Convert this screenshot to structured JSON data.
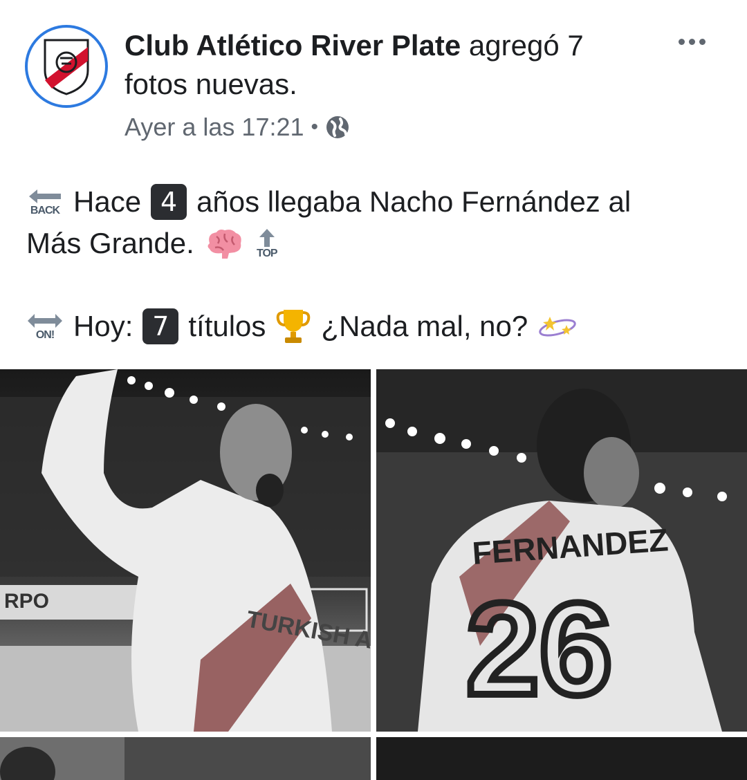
{
  "post": {
    "page_name": "Club Atlético River Plate",
    "action_text": " agregó 7 fotos nuevas.",
    "timestamp": "Ayer a las 17:21",
    "privacy_icon": "globe-icon",
    "more_icon": "more-icon"
  },
  "text": {
    "line1_prefix": "Hace",
    "line1_key": "4",
    "line1_rest": "años llegaba Nacho Fernández al",
    "line2": "Más Grande.",
    "line3_prefix": "Hoy:",
    "line3_key": "7",
    "line3_rest1": "títulos",
    "line3_rest2": "¿Nada mal, no?",
    "back_label": "BACK",
    "top_label": "TOP",
    "on_label": "ON!"
  },
  "photos": {
    "photo1_sponsor": "TURKISH AIRLINES",
    "photo2_name": "FERNANDEZ",
    "photo2_number": "26"
  },
  "colors": {
    "brand_blue": "#2d7ae0",
    "river_red": "#d2122e"
  }
}
